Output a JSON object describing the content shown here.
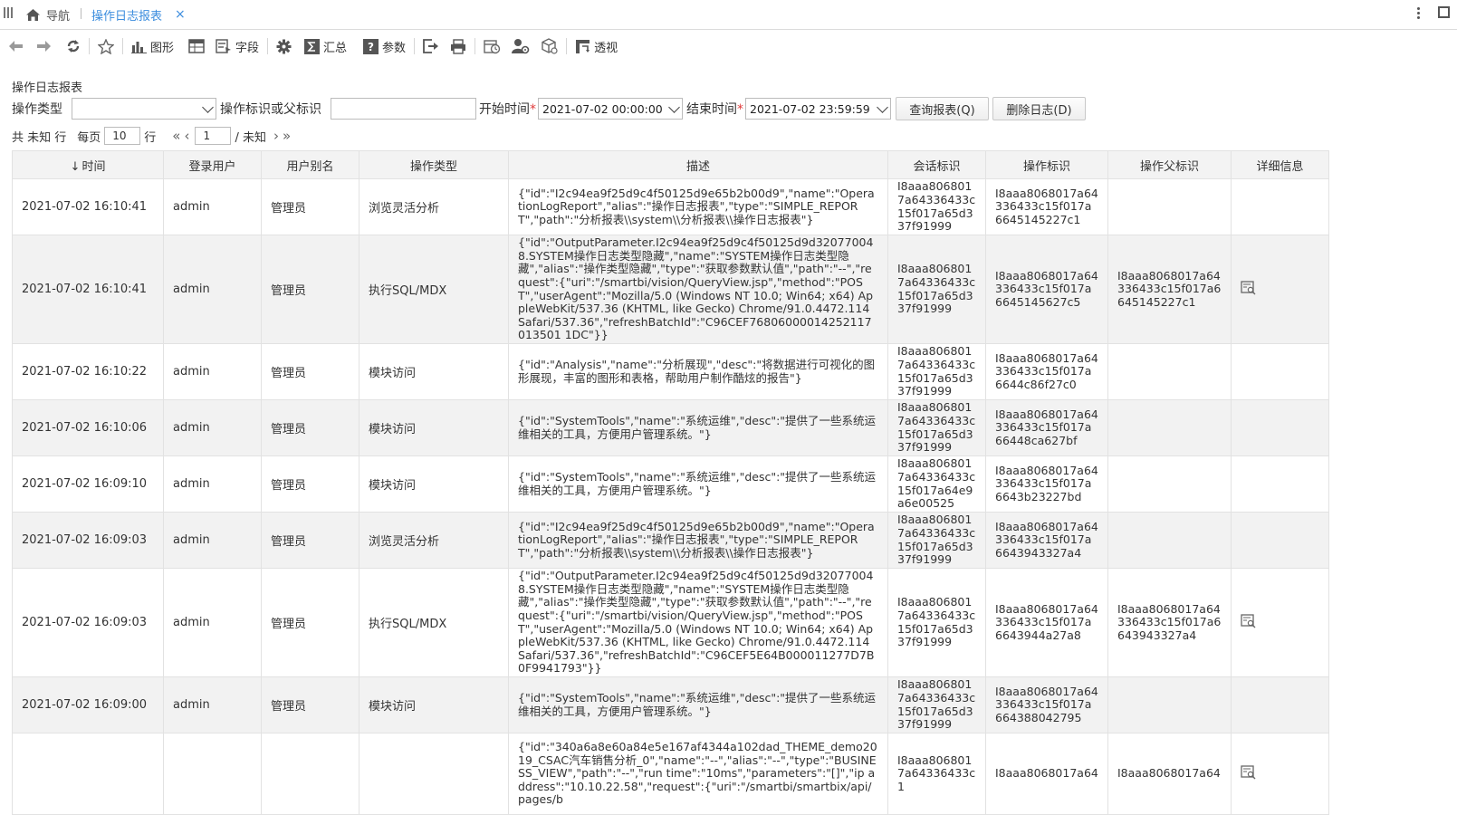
{
  "tabs": {
    "home_label": "导航",
    "active_label": "操作日志报表",
    "close_glyph": "×"
  },
  "toolbar": {
    "chart_label": "图形",
    "field_label": "字段",
    "summary_label": "汇总",
    "param_label": "参数",
    "pivot_label": "透视"
  },
  "report": {
    "title": "操作日志报表"
  },
  "params": {
    "op_type_label": "操作类型",
    "op_type_value": "",
    "op_id_label": "操作标识或父标识",
    "op_id_value": "",
    "start_label": "开始时间",
    "start_value": "2021-07-02 00:00:00",
    "end_label": "结束时间",
    "end_value": "2021-07-02 23:59:59",
    "required_mark": "*",
    "query_button": "查询报表(Q)",
    "delete_button": "删除日志(D)"
  },
  "pager": {
    "total_text": "共 未知 行",
    "per_page_label": "每页",
    "per_page_value": "10",
    "row_unit": "行",
    "page_value": "1",
    "page_total": "/ 未知"
  },
  "table": {
    "sort_glyph": "↓",
    "headers": {
      "time": "时间",
      "user": "登录用户",
      "alias": "用户别名",
      "op_type": "操作类型",
      "desc": "描述",
      "session": "会话标识",
      "op_id": "操作标识",
      "parent_id": "操作父标识",
      "detail": "详细信息"
    },
    "rows": [
      {
        "time": "2021-07-02 16:10:41",
        "user": "admin",
        "alias": "管理员",
        "op_type": "浏览灵活分析",
        "desc": "{\"id\":\"I2c94ea9f25d9c4f50125d9e65b2b00d9\",\"name\":\"OperationLogReport\",\"alias\":\"操作日志报表\",\"type\":\"SIMPLE_REPORT\",\"path\":\"分析报表\\\\system\\\\分析报表\\\\操作日志报表\"}",
        "session": "I8aaa8068017a64336433c15f017a65d337f91999",
        "op_id": "I8aaa8068017a64336433c15f017a6645145227c1",
        "parent_id": "",
        "has_detail": false
      },
      {
        "time": "2021-07-02 16:10:41",
        "user": "admin",
        "alias": "管理员",
        "op_type": "执行SQL/MDX",
        "desc": "{\"id\":\"OutputParameter.I2c94ea9f25d9c4f50125d9d320770048.SYSTEM操作日志类型隐藏\",\"name\":\"SYSTEM操作日志类型隐藏\",\"alias\":\"操作类型隐藏\",\"type\":\"获取参数默认值\",\"path\":\"--\",\"request\":{\"uri\":\"/smartbi/vision/QueryView.jsp\",\"method\":\"POST\",\"userAgent\":\"Mozilla/5.0 (Windows NT 10.0; Win64; x64) AppleWebKit/537.36 (KHTML, like Gecko) Chrome/91.0.4472.114 Safari/537.36\",\"refreshBatchId\":\"C96CEF76806000014252117013501 1DC\"}}",
        "session": "I8aaa8068017a64336433c15f017a65d337f91999",
        "op_id": "I8aaa8068017a64336433c15f017a6645145627c5",
        "parent_id": "I8aaa8068017a64336433c15f017a6645145227c1",
        "has_detail": true
      },
      {
        "time": "2021-07-02 16:10:22",
        "user": "admin",
        "alias": "管理员",
        "op_type": "模块访问",
        "desc": "{\"id\":\"Analysis\",\"name\":\"分析展现\",\"desc\":\"将数据进行可视化的图形展现，丰富的图形和表格，帮助用户制作酷炫的报告\"}",
        "session": "I8aaa8068017a64336433c15f017a65d337f91999",
        "op_id": "I8aaa8068017a64336433c15f017a6644c86f27c0",
        "parent_id": "",
        "has_detail": false
      },
      {
        "time": "2021-07-02 16:10:06",
        "user": "admin",
        "alias": "管理员",
        "op_type": "模块访问",
        "desc": "{\"id\":\"SystemTools\",\"name\":\"系统运维\",\"desc\":\"提供了一些系统运维相关的工具，方便用户管理系统。\"}",
        "session": "I8aaa8068017a64336433c15f017a65d337f91999",
        "op_id": "I8aaa8068017a64336433c15f017a66448ca627bf",
        "parent_id": "",
        "has_detail": false
      },
      {
        "time": "2021-07-02 16:09:10",
        "user": "admin",
        "alias": "管理员",
        "op_type": "模块访问",
        "desc": "{\"id\":\"SystemTools\",\"name\":\"系统运维\",\"desc\":\"提供了一些系统运维相关的工具，方便用户管理系统。\"}",
        "session": "I8aaa8068017a64336433c15f017a64e9a6e00525",
        "op_id": "I8aaa8068017a64336433c15f017a6643b23227bd",
        "parent_id": "",
        "has_detail": false
      },
      {
        "time": "2021-07-02 16:09:03",
        "user": "admin",
        "alias": "管理员",
        "op_type": "浏览灵活分析",
        "desc": "{\"id\":\"I2c94ea9f25d9c4f50125d9e65b2b00d9\",\"name\":\"OperationLogReport\",\"alias\":\"操作日志报表\",\"type\":\"SIMPLE_REPORT\",\"path\":\"分析报表\\\\system\\\\分析报表\\\\操作日志报表\"}",
        "session": "I8aaa8068017a64336433c15f017a65d337f91999",
        "op_id": "I8aaa8068017a64336433c15f017a6643943327a4",
        "parent_id": "",
        "has_detail": false
      },
      {
        "time": "2021-07-02 16:09:03",
        "user": "admin",
        "alias": "管理员",
        "op_type": "执行SQL/MDX",
        "desc": "{\"id\":\"OutputParameter.I2c94ea9f25d9c4f50125d9d320770048.SYSTEM操作日志类型隐藏\",\"name\":\"SYSTEM操作日志类型隐藏\",\"alias\":\"操作类型隐藏\",\"type\":\"获取参数默认值\",\"path\":\"--\",\"request\":{\"uri\":\"/smartbi/vision/QueryView.jsp\",\"method\":\"POST\",\"userAgent\":\"Mozilla/5.0 (Windows NT 10.0; Win64; x64) AppleWebKit/537.36 (KHTML, like Gecko) Chrome/91.0.4472.114 Safari/537.36\",\"refreshBatchId\":\"C96CEF5E64B000011277D7B0F9941793\"}}",
        "session": "I8aaa8068017a64336433c15f017a65d337f91999",
        "op_id": "I8aaa8068017a64336433c15f017a6643944a27a8",
        "parent_id": "I8aaa8068017a64336433c15f017a6643943327a4",
        "has_detail": true
      },
      {
        "time": "2021-07-02 16:09:00",
        "user": "admin",
        "alias": "管理员",
        "op_type": "模块访问",
        "desc": "{\"id\":\"SystemTools\",\"name\":\"系统运维\",\"desc\":\"提供了一些系统运维相关的工具，方便用户管理系统。\"}",
        "session": "I8aaa8068017a64336433c15f017a65d337f91999",
        "op_id": "I8aaa8068017a64336433c15f017a664388042795",
        "parent_id": "",
        "has_detail": false
      },
      {
        "time": "",
        "user": "",
        "alias": "",
        "op_type": "",
        "desc": "{\"id\":\"340a6a8e60a84e5e167af4344a102dad_THEME_demo2019_CSAC汽车销售分析_0\",\"name\":\"--\",\"alias\":\"--\",\"type\":\"BUSINESS_VIEW\",\"path\":\"--\",\"run time\":\"10ms\",\"parameters\":\"[]\",\"ip address\":\"10.10.22.58\",\"request\":{\"uri\":\"/smartbi/smartbix/api/pages/b",
        "session": "I8aaa8068017a64336433c1",
        "op_id": "I8aaa8068017a64",
        "parent_id": "I8aaa8068017a64",
        "has_detail": true
      }
    ]
  },
  "colors": {
    "accent": "#3c8dde",
    "required": "#e03a3a",
    "header_bg": "#f3f3f3",
    "alt_row_bg": "#f2f2f2",
    "border": "#e2e2e2"
  },
  "icons": [
    "menu-grip-icon",
    "home-icon",
    "more-vertical-icon",
    "maximize-icon",
    "back-icon",
    "forward-icon",
    "refresh-icon",
    "star-icon",
    "bar-chart-icon",
    "table-icon",
    "field-icon",
    "gear-icon",
    "sum-icon",
    "help-icon",
    "export-icon",
    "print-icon",
    "schedule-icon",
    "user-settings-icon",
    "cube-icon",
    "pivot-icon",
    "detail-icon"
  ]
}
